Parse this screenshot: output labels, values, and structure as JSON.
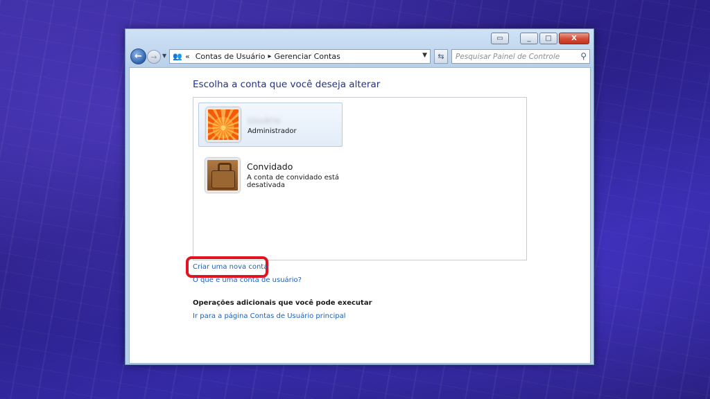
{
  "window": {
    "controls": {
      "close_glyph": "X",
      "min_glyph": "_",
      "max_glyph": "□"
    }
  },
  "nav": {
    "breadcrumb_prefix": "«",
    "breadcrumb": [
      "Contas de Usuário",
      "Gerenciar Contas"
    ],
    "search_placeholder": "Pesquisar Painel de Controle"
  },
  "main": {
    "heading": "Escolha a conta que você deseja alterar",
    "accounts": [
      {
        "name": "Usuário",
        "role": "Administrador",
        "selected": true,
        "avatar": "flower-avatar"
      },
      {
        "name": "Convidado",
        "role": "A conta de convidado está desativada",
        "selected": false,
        "avatar": "suitcase-avatar"
      }
    ],
    "links": {
      "create_account": "Criar uma nova conta",
      "what_is_account": "O que é uma conta de usuário?"
    },
    "additional_heading": "Operações adicionais que você pode executar",
    "main_page_link": "Ir para a página Contas de Usuário principal"
  },
  "colors": {
    "link": "#1d5fb8",
    "heading": "#1e3287",
    "highlight": "#e3121e",
    "background": "#2a1f86"
  }
}
